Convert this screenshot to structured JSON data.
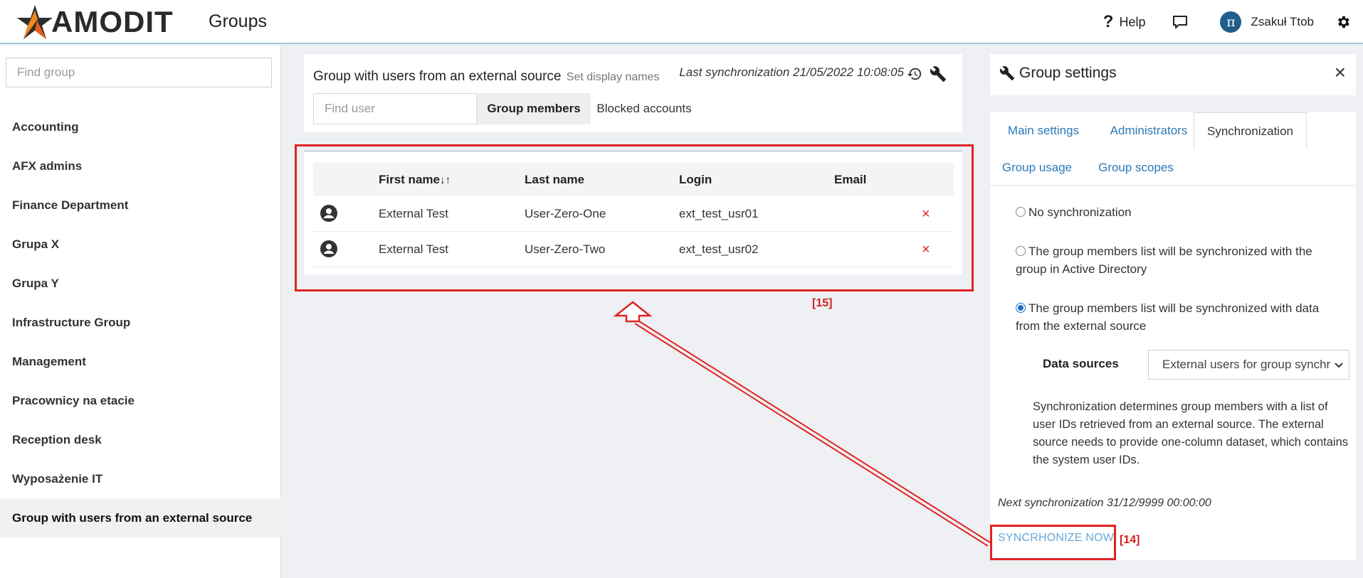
{
  "header": {
    "logo_text": "AMODIT",
    "page_title": "Groups",
    "help_label": "Help",
    "user_initial": "π",
    "user_name": "Zsakuł Ttob"
  },
  "sidebar": {
    "search_placeholder": "Find group",
    "groups": [
      "Accounting",
      "AFX admins",
      "Finance Department",
      "Grupa X",
      "Grupa Y",
      "Infrastructure Group",
      "Management",
      "Pracownicy na etacie",
      "Reception desk",
      "Wyposażenie IT",
      "Group with users from an external source"
    ],
    "active_index": 10
  },
  "group_card": {
    "title": "Group with users from an external source",
    "set_display_names": "Set display names",
    "last_sync": "Last synchronization 21/05/2022 10:08:05",
    "find_user_placeholder": "Find user",
    "tab_members": "Group members",
    "tab_blocked": "Blocked accounts"
  },
  "members_table": {
    "columns": [
      "First name",
      "Last name",
      "Login",
      "Email"
    ],
    "sort_indicator": "↓↑",
    "rows": [
      {
        "first": "External Test",
        "last": "User-Zero-One",
        "login": "ext_test_usr01",
        "email": ""
      },
      {
        "first": "External Test",
        "last": "User-Zero-Two",
        "login": "ext_test_usr02",
        "email": ""
      }
    ],
    "remove_symbol": "×"
  },
  "annotations": {
    "label_15": "[15]",
    "label_14": "[14]",
    "color": "#e02424"
  },
  "settings_panel": {
    "title": "Group settings",
    "close_symbol": "×",
    "tabs": [
      "Main settings",
      "Administrators",
      "Synchronization",
      "Group usage",
      "Group scopes"
    ],
    "active_tab": "Synchronization",
    "options": [
      {
        "label": "No synchronization",
        "checked": false
      },
      {
        "label": "The group members list will be synchronized with the group in Active Directory",
        "checked": false
      },
      {
        "label": "The group members list will be synchronized with data from the external source",
        "checked": true
      }
    ],
    "data_sources_label": "Data sources",
    "data_sources_value": "External users for group synchr",
    "description": "Synchronization determines group members with a list of user IDs retrieved from an external source. The external source needs to provide one-column dataset, which contains the system user IDs.",
    "next_sync": "Next synchronization 31/12/9999 00:00:00",
    "sync_now_label": "SYNCRHONIZE NOW"
  },
  "colors": {
    "accent_blue": "#2d79b7",
    "link_light_blue": "#6aa9d8",
    "danger_red": "#e02424"
  }
}
